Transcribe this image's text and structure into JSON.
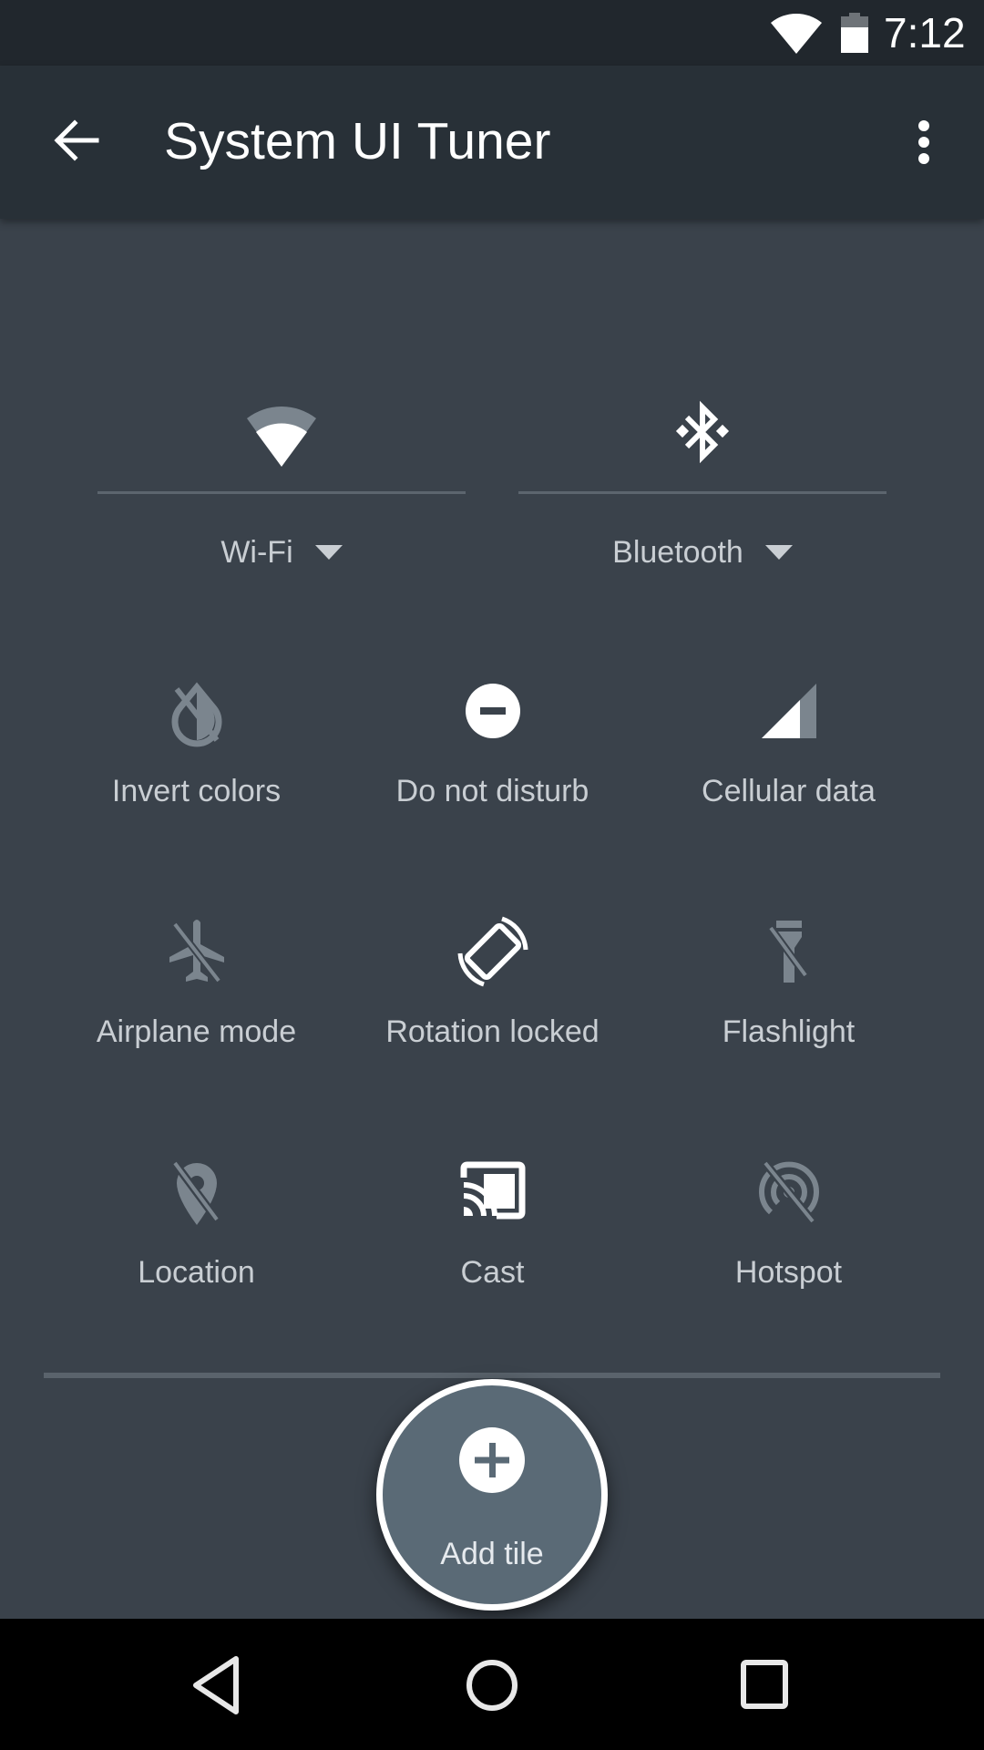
{
  "status_bar": {
    "time": "7:12",
    "icons": [
      "wifi-signal-icon",
      "battery-icon"
    ]
  },
  "toolbar": {
    "title": "System UI Tuner",
    "back_icon": "arrow-back-icon",
    "more_icon": "more-vert-icon"
  },
  "big_tiles": [
    {
      "label": "Wi-Fi",
      "icon": "wifi-icon",
      "has_dropdown": true
    },
    {
      "label": "Bluetooth",
      "icon": "bluetooth-icon",
      "has_dropdown": true
    }
  ],
  "tiles": [
    {
      "label": "Invert colors",
      "icon": "invert-colors-off-icon",
      "active": false
    },
    {
      "label": "Do not disturb",
      "icon": "do-not-disturb-icon",
      "active": true
    },
    {
      "label": "Cellular data",
      "icon": "cellular-signal-icon",
      "active": true
    },
    {
      "label": "Airplane mode",
      "icon": "airplane-off-icon",
      "active": false
    },
    {
      "label": "Rotation locked",
      "icon": "screen-rotation-icon",
      "active": true
    },
    {
      "label": "Flashlight",
      "icon": "flashlight-off-icon",
      "active": false
    },
    {
      "label": "Location",
      "icon": "location-off-icon",
      "active": false
    },
    {
      "label": "Cast",
      "icon": "cast-icon",
      "active": true
    },
    {
      "label": "Hotspot",
      "icon": "hotspot-off-icon",
      "active": false
    }
  ],
  "add_tile": {
    "label": "Add tile",
    "icon": "add-circle-icon"
  },
  "nav_bar": {
    "back": "nav-back-icon",
    "home": "nav-home-icon",
    "recents": "nav-recents-icon"
  },
  "colors": {
    "background": "#3a424b",
    "toolbar": "#283037",
    "status_bar": "#21272d",
    "label": "#c9ced3",
    "icon_active": "#ffffff",
    "icon_inactive": "#7b858e",
    "add_tile_fill": "#5a6a76"
  }
}
